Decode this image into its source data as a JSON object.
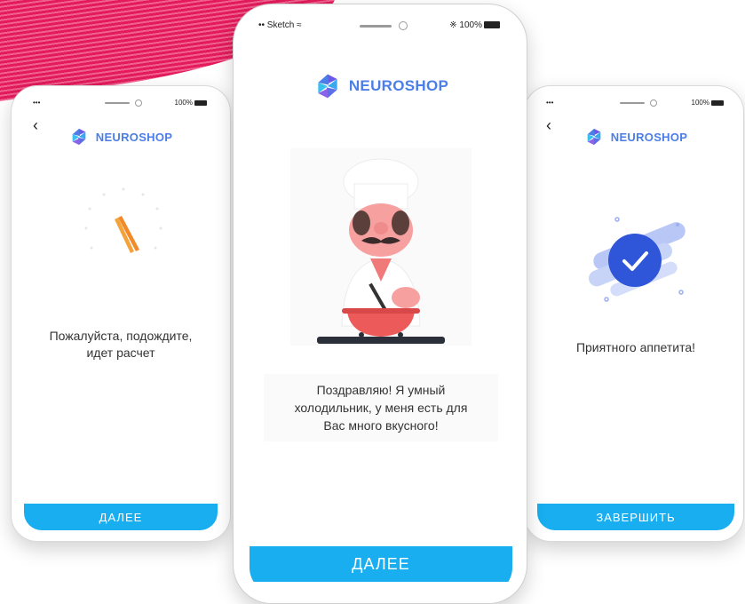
{
  "colors": {
    "accent": "#18aef0",
    "brand": "#4c7ee8",
    "stripe": "#e31b5a"
  },
  "left_phone": {
    "signal": "•••",
    "battery": "100%",
    "logo": "NEUROSHOP",
    "message_line1": "Пожалуйста, подождите,",
    "message_line2": "идет расчет",
    "button": "ДАЛЕЕ",
    "icons": {
      "back": "back-chevron-icon",
      "spinner": "loading-spinner-icon"
    }
  },
  "center_phone": {
    "carrier": "Sketch",
    "battery": "100%",
    "logo": "NEUROSHOP",
    "message_line1": "Поздравляю! Я умный",
    "message_line2": "холодильник, у меня есть для",
    "message_line3": "Вас много вкусного!",
    "button": "ДАЛЕЕ",
    "icons": {
      "illustration": "chef-cooking-illustration"
    }
  },
  "right_phone": {
    "battery": "100%",
    "logo": "NEUROSHOP",
    "message": "Приятного аппетита!",
    "button": "ЗАВЕРШИТЬ",
    "icons": {
      "back": "back-chevron-icon",
      "success": "checkmark-badge-icon"
    }
  }
}
